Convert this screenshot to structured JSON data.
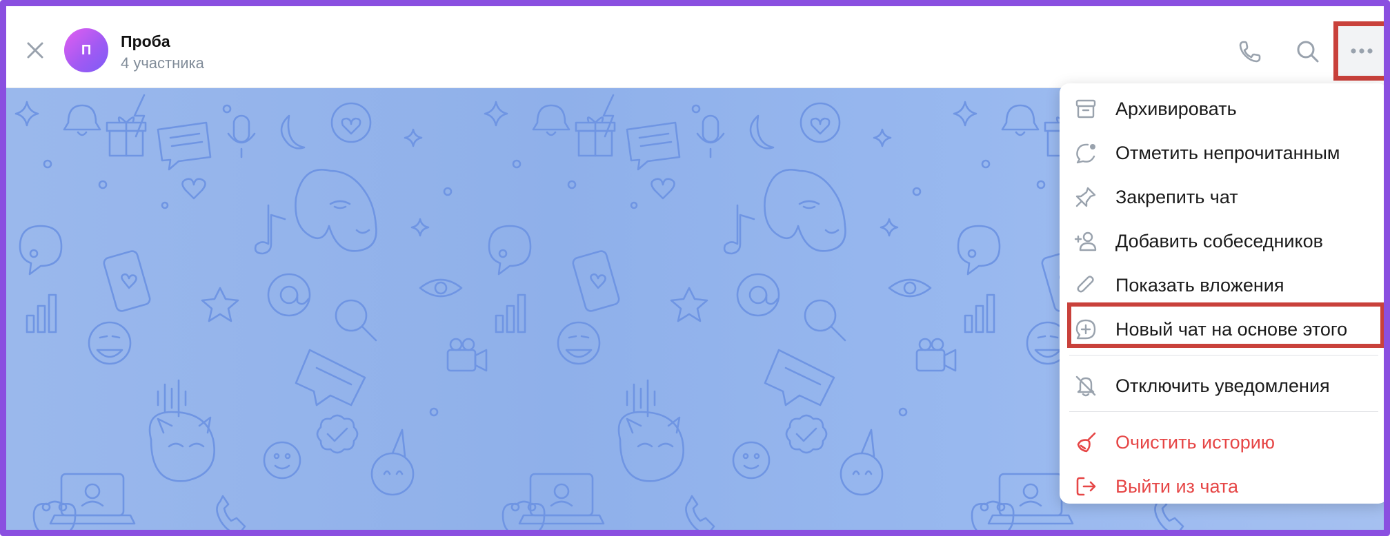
{
  "header": {
    "avatar_letter": "П",
    "title": "Проба",
    "subtitle": "4 участника"
  },
  "icons": {
    "close": "close-icon",
    "phone": "phone-icon",
    "search": "search-icon",
    "more": "more-horizontal-icon"
  },
  "menu": {
    "items": [
      {
        "label": "Архивировать",
        "icon": "archive-icon"
      },
      {
        "label": "Отметить непрочитанным",
        "icon": "mark-unread-icon"
      },
      {
        "label": "Закрепить чат",
        "icon": "pin-icon"
      },
      {
        "label": "Добавить собеседников",
        "icon": "add-user-icon"
      },
      {
        "label": "Показать вложения",
        "icon": "paperclip-icon"
      },
      {
        "label": "Новый чат на основе этого",
        "icon": "plus-chat-icon"
      },
      {
        "label": "Отключить уведомления",
        "icon": "bell-off-icon"
      },
      {
        "label": "Очистить историю",
        "icon": "broom-icon"
      },
      {
        "label": "Выйти из чата",
        "icon": "logout-icon"
      }
    ]
  },
  "colors": {
    "frame_border": "#8a4fe0",
    "highlight": "#c9413b",
    "danger_text": "#e64646",
    "icon_gray": "#99a2ad",
    "avatar_gradient_start": "#e35ef0",
    "avatar_gradient_end": "#7c5cf6",
    "chat_background": "#94b4ec",
    "doodle_stroke": "#6f95e3"
  }
}
